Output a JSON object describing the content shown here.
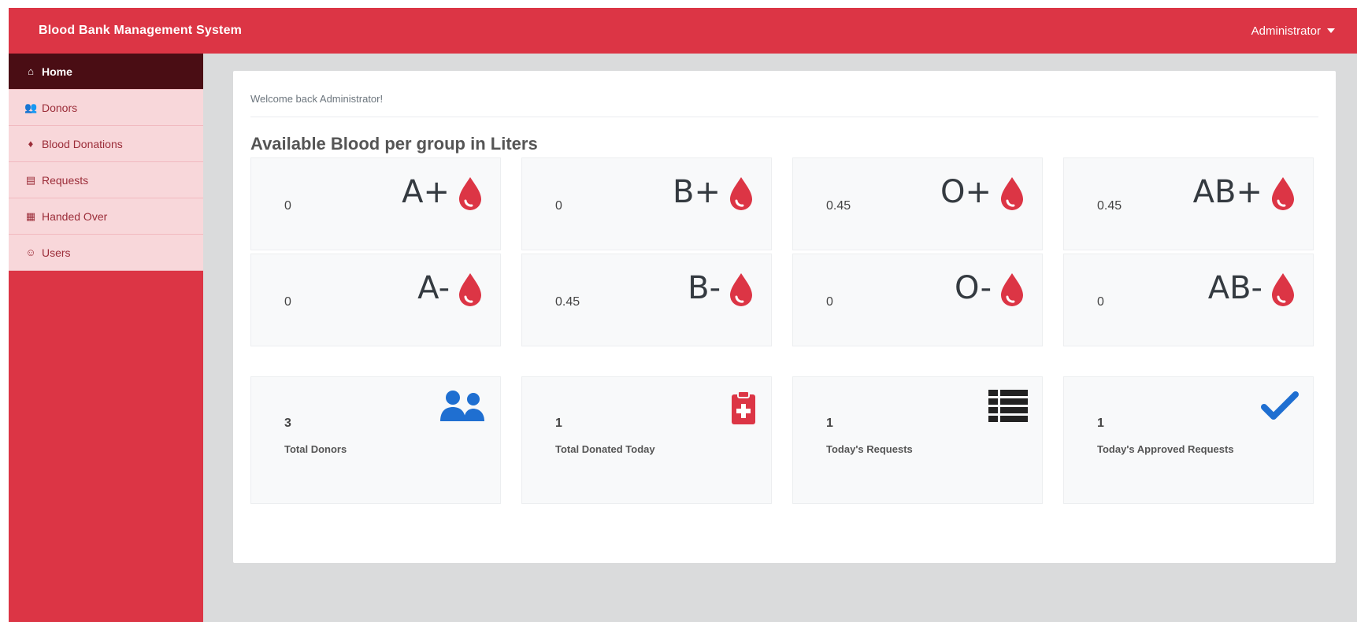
{
  "navbar": {
    "brand": "Blood Bank Management System",
    "user": "Administrator"
  },
  "sidebar": {
    "items": [
      {
        "label": "Home",
        "icon": "home-icon",
        "active": true
      },
      {
        "label": "Donors",
        "icon": "users-icon",
        "active": false
      },
      {
        "label": "Blood Donations",
        "icon": "droplet-icon",
        "active": false
      },
      {
        "label": "Requests",
        "icon": "list-icon",
        "active": false
      },
      {
        "label": "Handed Over",
        "icon": "building-icon",
        "active": false
      },
      {
        "label": "Users",
        "icon": "user-group-icon",
        "active": false
      }
    ]
  },
  "main": {
    "welcome": "Welcome back Administrator!",
    "title": "Available Blood per group in Liters",
    "blood_groups": [
      {
        "group": "A+",
        "value": "0"
      },
      {
        "group": "B+",
        "value": "0"
      },
      {
        "group": "O+",
        "value": "0.45"
      },
      {
        "group": "AB+",
        "value": "0.45"
      },
      {
        "group": "A-",
        "value": "0"
      },
      {
        "group": "B-",
        "value": "0.45"
      },
      {
        "group": "O-",
        "value": "0"
      },
      {
        "group": "AB-",
        "value": "0"
      }
    ],
    "stats": [
      {
        "value": "3",
        "label": "Total Donors",
        "icon": "users-icon"
      },
      {
        "value": "1",
        "label": "Total Donated Today",
        "icon": "medical-clipboard-icon"
      },
      {
        "value": "1",
        "label": "Today's Requests",
        "icon": "list-icon"
      },
      {
        "value": "1",
        "label": "Today's Approved Requests",
        "icon": "check-icon"
      }
    ]
  },
  "colors": {
    "brand": "#dc3545",
    "sidebar_active": "#4a0d14",
    "sidebar_item_bg": "#f8d7da",
    "stat_icon_blue": "#1f6fd1",
    "stat_icon_dark": "#222222"
  }
}
